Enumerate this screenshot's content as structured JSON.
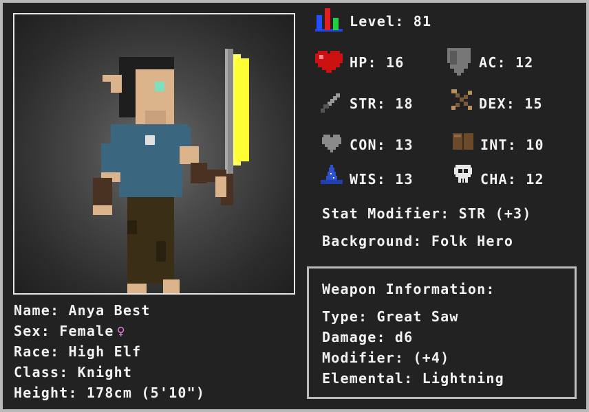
{
  "level": {
    "label": "Level:",
    "value": "81"
  },
  "stats": {
    "hp": {
      "label": "HP:",
      "value": "16",
      "color": "#cc1111"
    },
    "ac": {
      "label": "AC:",
      "value": "12"
    },
    "str": {
      "label": "STR:",
      "value": "18"
    },
    "dex": {
      "label": "DEX:",
      "value": "15"
    },
    "con": {
      "label": "CON:",
      "value": "13"
    },
    "int": {
      "label": "INT:",
      "value": "10"
    },
    "wis": {
      "label": "WIS:",
      "value": "13"
    },
    "cha": {
      "label": "CHA:",
      "value": "12"
    }
  },
  "stat_modifier": "Stat Modifier: STR (+3)",
  "background": "Background: Folk Hero",
  "character": {
    "name": "Name: Anya Best",
    "sex": "Sex: Female",
    "sex_symbol": "♀",
    "race": "Race: High Elf",
    "class": "Class: Knight",
    "height": "Height: 178cm (5'10\")"
  },
  "weapon": {
    "title": "Weapon Information:",
    "type": "Type: Great Saw",
    "damage": "Damage: d6",
    "modifier": "Modifier: (+4)",
    "elemental": "Elemental: Lightning"
  },
  "icons": {
    "level": "bar-chart-icon",
    "hp": "heart-icon",
    "ac": "shield-icon",
    "str": "sword-icon",
    "dex": "crossed-arrows-icon",
    "con": "heart-outline-icon",
    "int": "book-icon",
    "wis": "wizard-hat-icon",
    "cha": "skull-icon"
  },
  "colors": {
    "background": "#222222",
    "text": "#f2f2f2",
    "accent_female": "#e07ee0",
    "blade_glow": "#ffff33"
  }
}
